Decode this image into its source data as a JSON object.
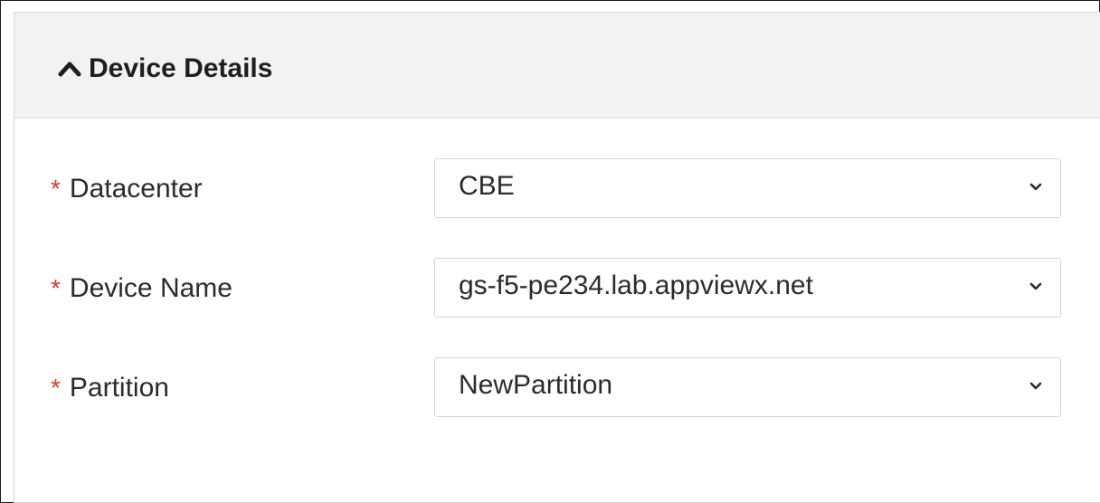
{
  "panel": {
    "title": "Device Details",
    "collapse_icon": "chevron-up-icon"
  },
  "form": {
    "required_marker": "*",
    "fields": [
      {
        "label": "Datacenter",
        "value": "CBE",
        "icon": "chevron-down-icon"
      },
      {
        "label": "Device Name",
        "value": "gs-f5-pe234.lab.appviewx.net",
        "icon": "chevron-down-icon"
      },
      {
        "label": "Partition",
        "value": "NewPartition",
        "icon": "chevron-down-icon"
      }
    ]
  },
  "colors": {
    "header_background": "#f2f2f2",
    "required_marker": "#e0362b",
    "text": "#2b2b2b",
    "border": "#d6d6d6"
  }
}
